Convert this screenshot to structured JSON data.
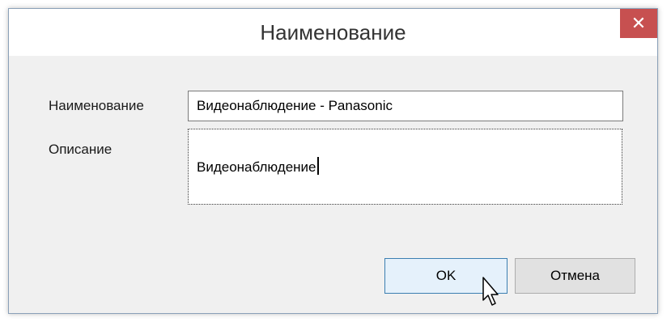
{
  "dialog": {
    "title": "Наименование",
    "close_label": "✕"
  },
  "form": {
    "name_label": "Наименование",
    "name_value": "Видеонаблюдение - Panasonic",
    "description_label": "Описание",
    "description_value": "Видеонаблюдение"
  },
  "buttons": {
    "ok_label": "OK",
    "cancel_label": "Отмена"
  },
  "icons": {
    "close": "close-icon",
    "cursor": "mouse-pointer-icon"
  },
  "colors": {
    "close_button": "#c75050",
    "ok_button_border": "#3c7fb1",
    "dialog_background": "#f0f0f0"
  }
}
